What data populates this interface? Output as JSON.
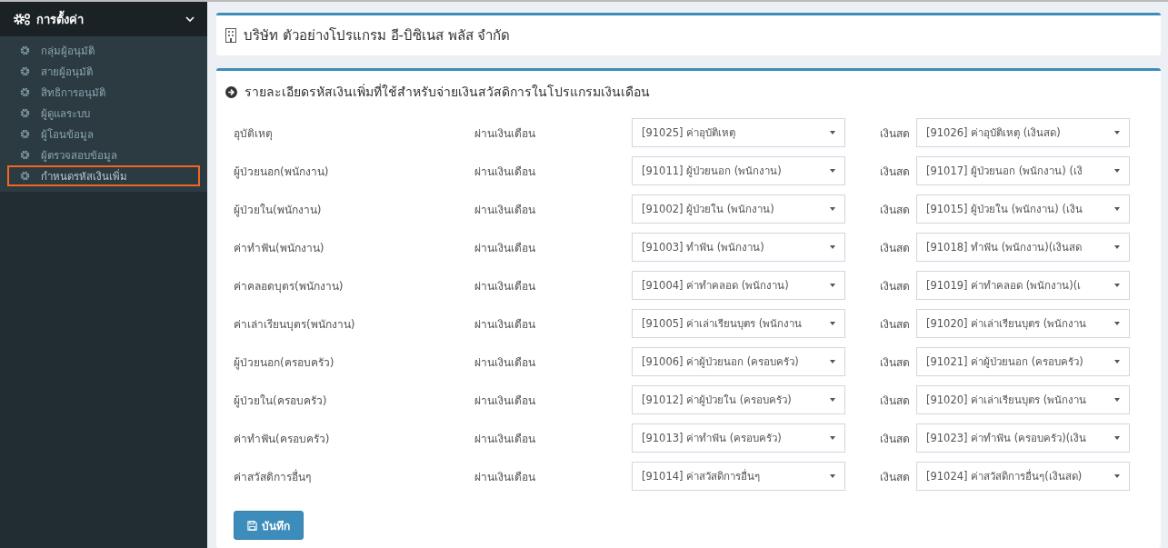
{
  "sidebar": {
    "header": {
      "label": "การตั้งค่า",
      "expanded": true
    },
    "items": [
      {
        "label": "กลุ่มผู้อนุมัติ",
        "selected": false
      },
      {
        "label": "สายผู้อนุมัติ",
        "selected": false
      },
      {
        "label": "สิทธิการอนุมัติ",
        "selected": false
      },
      {
        "label": "ผู้ดูแลระบบ",
        "selected": false
      },
      {
        "label": "ผู้โอนข้อมูล",
        "selected": false
      },
      {
        "label": "ผู้ตรวจสอบข้อมูล",
        "selected": false
      },
      {
        "label": "กำหนดรหัสเงินเพิ่ม",
        "selected": true
      }
    ]
  },
  "company": {
    "name": "บริษัท ตัวอย่างโปรแกรม อี-บิซิเนส พลัส จำกัด"
  },
  "form": {
    "title": "รายละเอียดรหัสเงินเพิ่มที่ใช้สำหรับจ่ายเงินสวัสดิการในโปรแกรมเงินเดือน",
    "rows": [
      {
        "label": "อุบัติเหตุ",
        "payroll_label": "ผ่านเงินเดือน",
        "payroll_value": "[91025] ค่าอุบัติเหตุ",
        "cash_label": "เงินสด",
        "cash_value": "[91026] ค่าอุบัติเหตุ (เงินสด)"
      },
      {
        "label": "ผู้ป่วยนอก(พนักงาน)",
        "payroll_label": "ผ่านเงินเดือน",
        "payroll_value": "[91011] ผู้ป่วยนอก (พนักงาน)",
        "cash_label": "เงินสด",
        "cash_value": "[91017] ผู้ป่วยนอก (พนักงาน) (เงิ"
      },
      {
        "label": "ผู้ป่วยใน(พนักงาน)",
        "payroll_label": "ผ่านเงินเดือน",
        "payroll_value": "[91002] ผู้ป่วยใน (พนักงาน)",
        "cash_label": "เงินสด",
        "cash_value": "[91015] ผู้ป่วยใน (พนักงาน) (เงิน"
      },
      {
        "label": "ค่าทำฟัน(พนักงาน)",
        "payroll_label": "ผ่านเงินเดือน",
        "payroll_value": "[91003] ทำฟัน (พนักงาน)",
        "cash_label": "เงินสด",
        "cash_value": "[91018] ทำฟัน (พนักงาน)(เงินสด"
      },
      {
        "label": "ค่าคลอดบุตร(พนักงาน)",
        "payroll_label": "ผ่านเงินเดือน",
        "payroll_value": "[91004] ค่าทำคลอด (พนักงาน)",
        "cash_label": "เงินสด",
        "cash_value": "[91019] ค่าทำคลอด (พนักงาน)(เ"
      },
      {
        "label": "ค่าเล่าเรียนบุตร(พนักงาน)",
        "payroll_label": "ผ่านเงินเดือน",
        "payroll_value": "[91005] ค่าเล่าเรียนบุตร (พนักงาน",
        "cash_label": "เงินสด",
        "cash_value": "[91020] ค่าเล่าเรียนบุตร (พนักงาน"
      },
      {
        "label": "ผู้ป่วยนอก(ครอบครัว)",
        "payroll_label": "ผ่านเงินเดือน",
        "payroll_value": "[91006] ค่าผู้ป่วยนอก (ครอบครัว)",
        "cash_label": "เงินสด",
        "cash_value": "[91021] ค่าผู้ป่วยนอก (ครอบครัว)"
      },
      {
        "label": "ผู้ป่วยใน(ครอบครัว)",
        "payroll_label": "ผ่านเงินเดือน",
        "payroll_value": "[91012] ค่าผู้ป่วยใน (ครอบครัว)",
        "cash_label": "เงินสด",
        "cash_value": "[91020] ค่าเล่าเรียนบุตร (พนักงาน"
      },
      {
        "label": "ค่าทำฟัน(ครอบครัว)",
        "payroll_label": "ผ่านเงินเดือน",
        "payroll_value": "[91013] ค่าทำฟัน (ครอบครัว)",
        "cash_label": "เงินสด",
        "cash_value": "[91023] ค่าทำฟัน (ครอบครัว)(เงิน"
      },
      {
        "label": "ค่าสวัสดิการอื่นๆ",
        "payroll_label": "ผ่านเงินเดือน",
        "payroll_value": "[91014] ค่าสวัสดิการอื่นๆ",
        "cash_label": "เงินสด",
        "cash_value": "[91024] ค่าสวัสดิการอื่นๆ(เงินสด)"
      }
    ],
    "save_button": "บันทึก"
  }
}
